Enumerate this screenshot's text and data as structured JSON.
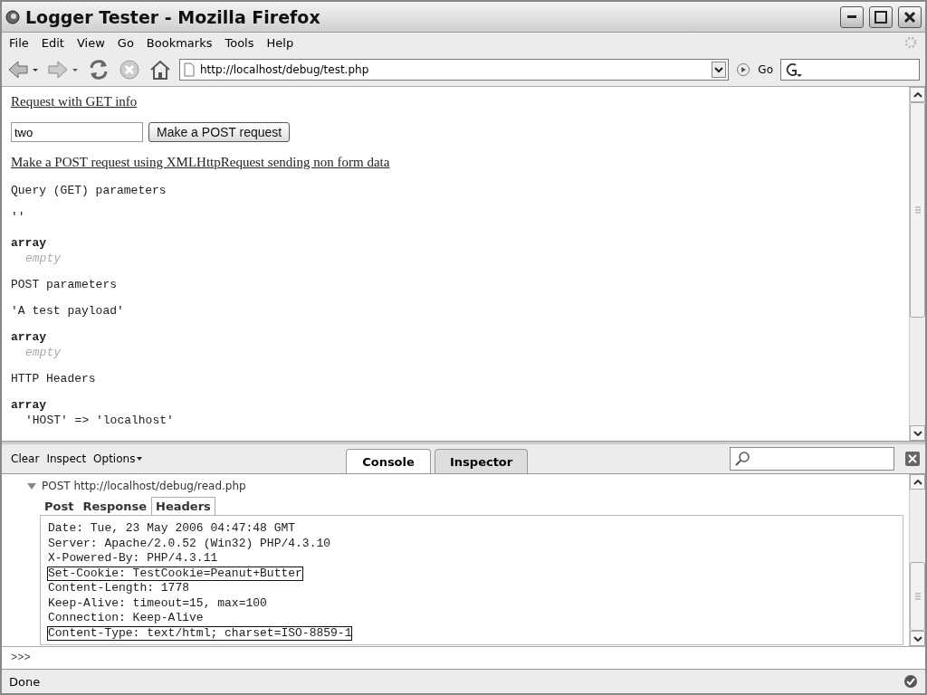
{
  "window": {
    "title": "Logger Tester - Mozilla Firefox"
  },
  "menu": [
    "File",
    "Edit",
    "View",
    "Go",
    "Bookmarks",
    "Tools",
    "Help"
  ],
  "address_bar": {
    "url": "http://localhost/debug/test.php",
    "go": "Go"
  },
  "page": {
    "link_get": "Request with GET info",
    "input": {
      "value": "two"
    },
    "button": "Make a POST request",
    "link_xhr": "Make a POST request using XMLHttpRequest sending non form data",
    "blocks": [
      {
        "lines": [
          {
            "kind": "plain",
            "text": "Query (GET) parameters"
          }
        ]
      },
      {
        "lines": [
          {
            "kind": "plain",
            "text": "''"
          }
        ]
      },
      {
        "lines": [
          {
            "kind": "bold",
            "text": "array"
          },
          {
            "kind": "muted",
            "text": "empty"
          }
        ]
      },
      {
        "lines": [
          {
            "kind": "plain",
            "text": "POST parameters"
          }
        ]
      },
      {
        "lines": [
          {
            "kind": "plain",
            "text": "'A test payload'"
          }
        ]
      },
      {
        "lines": [
          {
            "kind": "bold",
            "text": "array"
          },
          {
            "kind": "muted",
            "text": "empty"
          }
        ]
      },
      {
        "lines": [
          {
            "kind": "plain",
            "text": "HTTP Headers"
          }
        ]
      },
      {
        "lines": [
          {
            "kind": "bold",
            "text": "array"
          },
          {
            "kind": "entry",
            "text": "'HOST' => 'localhost'"
          }
        ]
      }
    ]
  },
  "firebug": {
    "toolbar": [
      {
        "label": "Clear",
        "caret": false
      },
      {
        "label": "Inspect",
        "caret": false
      },
      {
        "label": "Options",
        "caret": true
      }
    ],
    "tabs": [
      {
        "label": "Console",
        "selected": true
      },
      {
        "label": "Inspector",
        "selected": false
      }
    ],
    "entry": {
      "request": "POST http://localhost/debug/read.php",
      "expanded": true,
      "tabs": [
        {
          "label": "Post",
          "selected": false
        },
        {
          "label": "Response",
          "selected": false
        },
        {
          "label": "Headers",
          "selected": true
        }
      ],
      "headers": [
        {
          "text": "Date: Tue, 23 May 2006 04:47:48 GMT",
          "highlighted": false
        },
        {
          "text": "Server: Apache/2.0.52 (Win32) PHP/4.3.10",
          "highlighted": false
        },
        {
          "text": "X-Powered-By: PHP/4.3.11",
          "highlighted": false
        },
        {
          "text": "Set-Cookie: TestCookie=Peanut+Butter",
          "highlighted": true
        },
        {
          "text": "Content-Length: 1778",
          "highlighted": false
        },
        {
          "text": "Keep-Alive: timeout=15, max=100",
          "highlighted": false
        },
        {
          "text": "Connection: Keep-Alive",
          "highlighted": false
        },
        {
          "text": "Content-Type: text/html; charset=ISO-8859-1",
          "highlighted": true
        }
      ]
    },
    "prompt": ">>>"
  },
  "status_bar": {
    "text": "Done"
  }
}
